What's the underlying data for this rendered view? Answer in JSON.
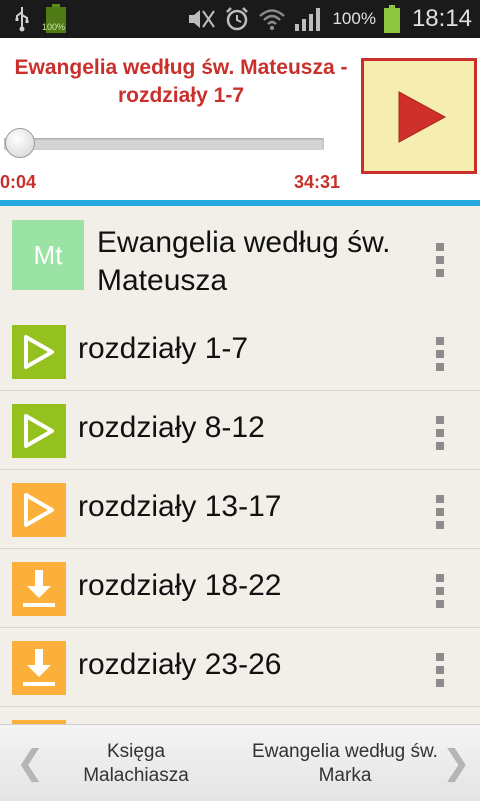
{
  "status_bar": {
    "battery_small_label": "100%",
    "battery_percent": "100%",
    "time": "18:14"
  },
  "player": {
    "title": "Ewangelia według św. Mateusza - rozdziały 1-7",
    "elapsed": "0:04",
    "total": "34:31",
    "progress_fraction": 0.002,
    "colors": {
      "accent": "#c9302c",
      "divider": "#27a9e1"
    }
  },
  "book": {
    "badge": "Mt",
    "title": "Ewangelia według św. Mateusza"
  },
  "chapters": [
    {
      "label": "rozdziały 1-7",
      "state": "play",
      "color": "#95c11f"
    },
    {
      "label": "rozdziały 8-12",
      "state": "play",
      "color": "#95c11f"
    },
    {
      "label": "rozdziały 13-17",
      "state": "play",
      "color": "#fbb03b"
    },
    {
      "label": "rozdziały 18-22",
      "state": "download",
      "color": "#fbb03b"
    },
    {
      "label": "rozdziały 23-26",
      "state": "download",
      "color": "#fbb03b"
    }
  ],
  "bottom_nav": {
    "prev": "Księga Malachiasza",
    "next": "Ewangelia według św. Marka",
    "prev_arrow": "❮",
    "next_arrow": "❯"
  }
}
